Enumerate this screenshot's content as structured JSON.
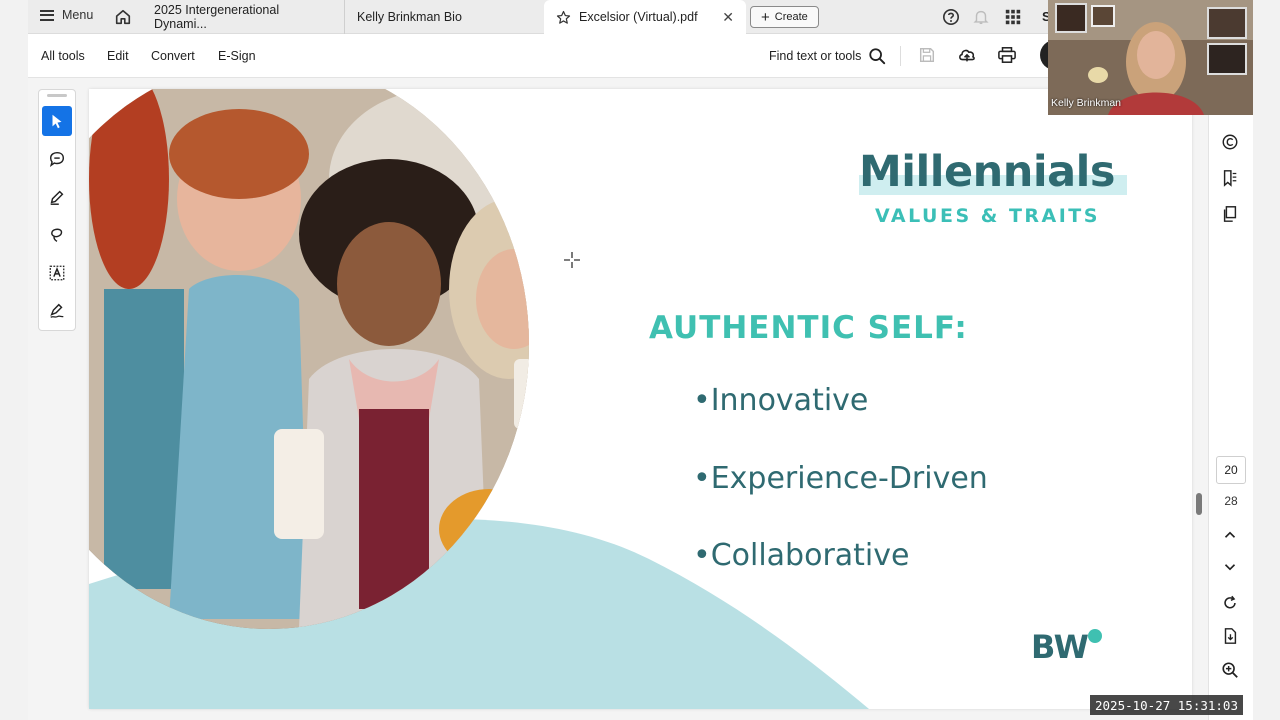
{
  "tabbar": {
    "menu_label": "Menu",
    "tabs": [
      {
        "label": "2025 Intergenerational Dynami..."
      },
      {
        "label": "Kelly Brinkman Bio"
      },
      {
        "label": "Excelsior (Virtual).pdf",
        "close": "✕"
      }
    ],
    "create_label": "Create",
    "account_letter": "S"
  },
  "toolbar": {
    "all_tools": "All tools",
    "edit": "Edit",
    "convert": "Convert",
    "esign": "E-Sign",
    "find": "Find text or tools"
  },
  "slide": {
    "title": "Millennials",
    "subtitle": "VALUES & TRAITS",
    "heading": "AUTHENTIC SELF:",
    "bullets": [
      "•Innovative",
      "•Experience-Driven",
      "•Collaborative"
    ],
    "logo_text": "BW"
  },
  "navigation": {
    "current_page": "20",
    "total_pages": "28"
  },
  "video": {
    "participant_name": "Kelly Brinkman"
  },
  "timestamp": "2025-10-27  15:31:03",
  "colors": {
    "accent": "#1473e6",
    "title": "#2f6a71",
    "teal": "#3fc0b1",
    "wave": "#b9e0e4"
  }
}
